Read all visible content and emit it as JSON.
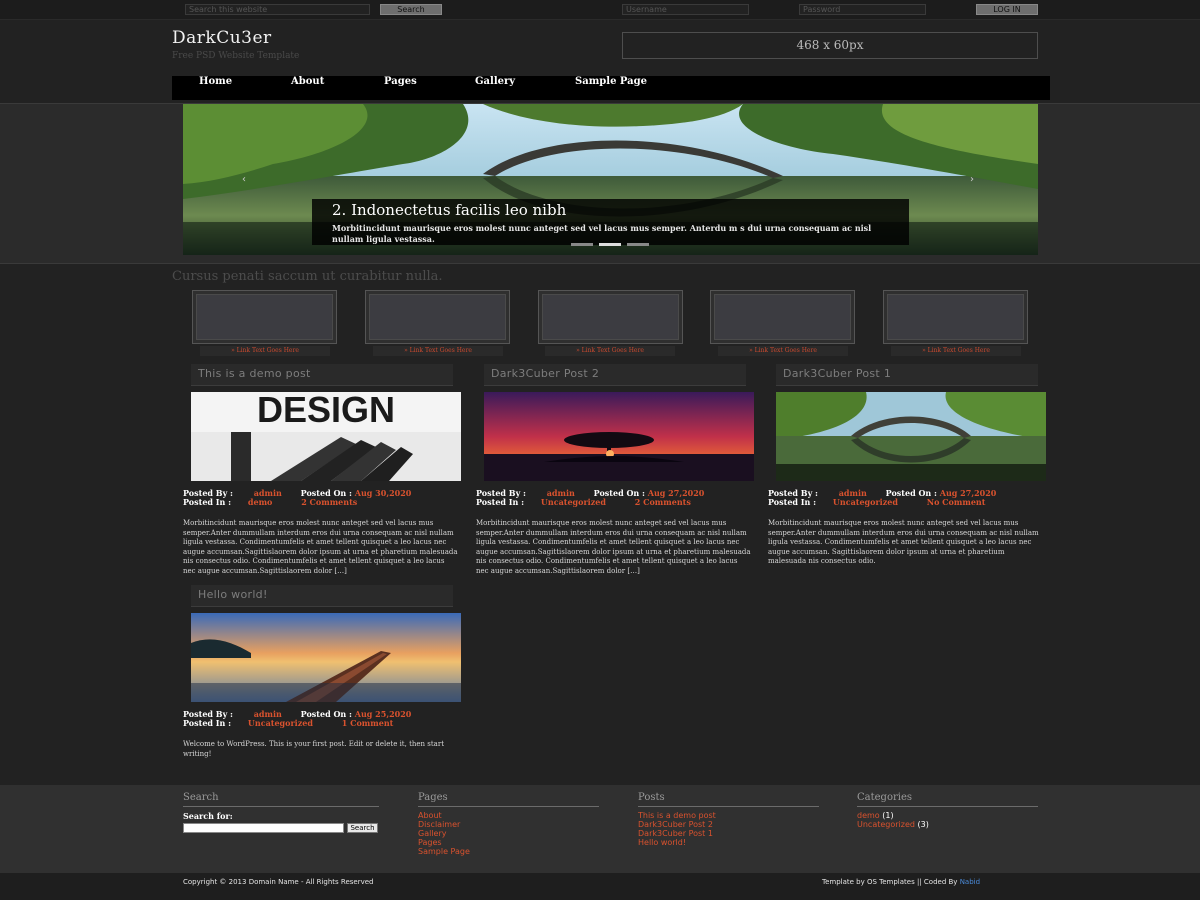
{
  "topbar": {
    "search_placeholder": "Search this website",
    "search_button": "Search",
    "username_placeholder": "Username",
    "password_placeholder": "Password",
    "login_button": "LOG IN"
  },
  "header": {
    "logo": "DarkCu3er",
    "tagline": "Free PSD Website Template",
    "ad_text": "468 x 60px"
  },
  "nav": [
    "Home",
    "About",
    "Pages",
    "Gallery",
    "Sample Page"
  ],
  "slider": {
    "prev_icon": "‹",
    "next_icon": "›",
    "caption_title": "2. Indonectetus facilis leo nibh",
    "caption_text": "Morbitincidunt maurisque eros molest nunc anteget sed vel lacus mus semper. Anterdu m s dui urna consequam ac nisl nullam ligula vestassa.",
    "active_slide": 2,
    "slide_count": 3
  },
  "section_heading": "Cursus penati saccum ut curabitur nulla.",
  "thumbs": {
    "link_text": "» Link Text Goes Here"
  },
  "post_labels": {
    "posted_by": "Posted By :",
    "posted_on": "Posted On :",
    "posted_in": "Posted In :"
  },
  "posts": [
    {
      "title": "This is a demo post",
      "author": "admin",
      "date": "Aug 30,2020",
      "category": "demo",
      "comments": "2 Comments",
      "image_text": "DESIGN",
      "excerpt": "Morbitincidunt maurisque eros molest nunc anteget sed vel lacus mus semper.Anter dummullam interdum eros dui urna consequam ac nisl nullam ligula vestassa. Condimentumfelis et amet tellent quisquet a leo lacus nec augue accumsan.Sagittislaorem dolor ipsum at urna et pharetium malesuada nis consectus odio. Condimentumfelis et amet tellent quisquet a leo lacus nec augue accumsan.Sagittislaorem dolor […]"
    },
    {
      "title": "Dark3Cuber Post 2",
      "author": "admin",
      "date": "Aug 27,2020",
      "category": "Uncategorized",
      "comments": "2 Comments",
      "excerpt": "Morbitincidunt maurisque eros molest nunc anteget sed vel lacus mus semper.Anter dummullam interdum eros dui urna consequam ac nisl nullam ligula vestassa. Condimentumfelis et amet tellent quisquet a leo lacus nec augue accumsan.Sagittislaorem dolor ipsum at urna et pharetium malesuada nis consectus odio. Condimentumfelis et amet tellent quisquet a leo lacus nec augue accumsan.Sagittislaorem dolor […]"
    },
    {
      "title": "Dark3Cuber Post 1",
      "author": "admin",
      "date": "Aug 27,2020",
      "category": "Uncategorized",
      "comments": "No Comment",
      "excerpt": "Morbitincidunt maurisque eros molest nunc anteget sed vel lacus mus semper.Anter dummullam interdum eros dui urna consequam ac nisl nullam ligula vestassa. Condimentumfelis et amet tellent quisquet a leo lacus nec augue accumsan. Sagittislaorem dolor ipsum at urna et pharetium malesuada nis consectus odio."
    },
    {
      "title": "Hello world!",
      "author": "admin",
      "date": "Aug 25,2020",
      "category": "Uncategorized",
      "comments": "1 Comment",
      "excerpt": "Welcome to WordPress. This is your first post. Edit or delete it, then start writing!"
    }
  ],
  "footer": {
    "search": {
      "title": "Search",
      "label": "Search for:",
      "button": "Search"
    },
    "pages": {
      "title": "Pages",
      "items": [
        "About",
        "Disclaimer",
        "Gallery",
        "Pages",
        "Sample Page"
      ]
    },
    "posts": {
      "title": "Posts",
      "items": [
        "This is a demo post",
        "Dark3Cuber Post 2",
        "Dark3Cuber Post 1",
        "Hello world!"
      ]
    },
    "categories": {
      "title": "Categories",
      "items": [
        {
          "name": "demo",
          "count": "(1)"
        },
        {
          "name": "Uncategorized",
          "count": "(3)"
        }
      ]
    },
    "copyright": "Copyright © 2013 Domain Name - All Rights Reserved",
    "credit_prefix": "Template by OS Templates || Coded By",
    "credit_link": "Nabid"
  },
  "colors": {
    "background": "#222222",
    "accent": "#d9522e",
    "nav_background": "#000000",
    "credit_link": "#4a8ad8"
  }
}
